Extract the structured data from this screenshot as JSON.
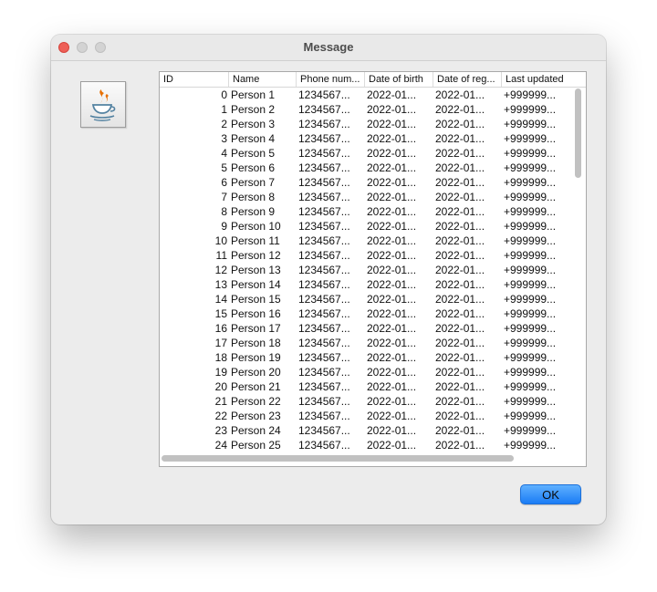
{
  "window": {
    "title": "Message"
  },
  "icon": {
    "name": "java-cup-icon"
  },
  "table": {
    "columns": [
      "ID",
      "Name",
      "Phone num...",
      "Date of birth",
      "Date of reg...",
      "Last updated"
    ],
    "rows": [
      [
        "0",
        "Person 1",
        "1234567...",
        "2022-01...",
        "2022-01...",
        "+999999..."
      ],
      [
        "1",
        "Person 2",
        "1234567...",
        "2022-01...",
        "2022-01...",
        "+999999..."
      ],
      [
        "2",
        "Person 3",
        "1234567...",
        "2022-01...",
        "2022-01...",
        "+999999..."
      ],
      [
        "3",
        "Person 4",
        "1234567...",
        "2022-01...",
        "2022-01...",
        "+999999..."
      ],
      [
        "4",
        "Person 5",
        "1234567...",
        "2022-01...",
        "2022-01...",
        "+999999..."
      ],
      [
        "5",
        "Person 6",
        "1234567...",
        "2022-01...",
        "2022-01...",
        "+999999..."
      ],
      [
        "6",
        "Person 7",
        "1234567...",
        "2022-01...",
        "2022-01...",
        "+999999..."
      ],
      [
        "7",
        "Person 8",
        "1234567...",
        "2022-01...",
        "2022-01...",
        "+999999..."
      ],
      [
        "8",
        "Person 9",
        "1234567...",
        "2022-01...",
        "2022-01...",
        "+999999..."
      ],
      [
        "9",
        "Person 10",
        "1234567...",
        "2022-01...",
        "2022-01...",
        "+999999..."
      ],
      [
        "10",
        "Person 11",
        "1234567...",
        "2022-01...",
        "2022-01...",
        "+999999..."
      ],
      [
        "11",
        "Person 12",
        "1234567...",
        "2022-01...",
        "2022-01...",
        "+999999..."
      ],
      [
        "12",
        "Person 13",
        "1234567...",
        "2022-01...",
        "2022-01...",
        "+999999..."
      ],
      [
        "13",
        "Person 14",
        "1234567...",
        "2022-01...",
        "2022-01...",
        "+999999..."
      ],
      [
        "14",
        "Person 15",
        "1234567...",
        "2022-01...",
        "2022-01...",
        "+999999..."
      ],
      [
        "15",
        "Person 16",
        "1234567...",
        "2022-01...",
        "2022-01...",
        "+999999..."
      ],
      [
        "16",
        "Person 17",
        "1234567...",
        "2022-01...",
        "2022-01...",
        "+999999..."
      ],
      [
        "17",
        "Person 18",
        "1234567...",
        "2022-01...",
        "2022-01...",
        "+999999..."
      ],
      [
        "18",
        "Person 19",
        "1234567...",
        "2022-01...",
        "2022-01...",
        "+999999..."
      ],
      [
        "19",
        "Person 20",
        "1234567...",
        "2022-01...",
        "2022-01...",
        "+999999..."
      ],
      [
        "20",
        "Person 21",
        "1234567...",
        "2022-01...",
        "2022-01...",
        "+999999..."
      ],
      [
        "21",
        "Person 22",
        "1234567...",
        "2022-01...",
        "2022-01...",
        "+999999..."
      ],
      [
        "22",
        "Person 23",
        "1234567...",
        "2022-01...",
        "2022-01...",
        "+999999..."
      ],
      [
        "23",
        "Person 24",
        "1234567...",
        "2022-01...",
        "2022-01...",
        "+999999..."
      ],
      [
        "24",
        "Person 25",
        "1234567...",
        "2022-01...",
        "2022-01...",
        "+999999..."
      ]
    ]
  },
  "buttons": {
    "ok_label": "OK"
  },
  "colors": {
    "close_button": "#ee5f57",
    "accent_button": "#1a7cf5",
    "window_background": "#ececec"
  }
}
